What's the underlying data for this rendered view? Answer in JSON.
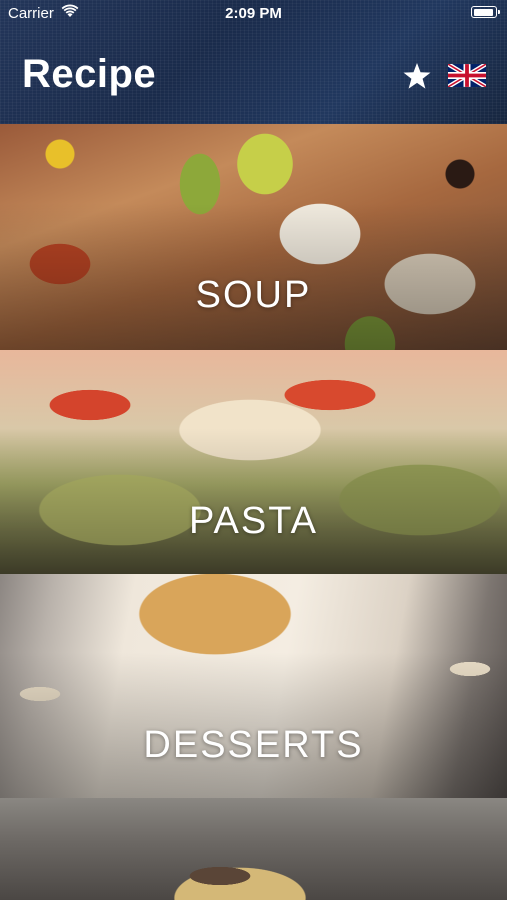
{
  "status_bar": {
    "carrier": "Carrier",
    "time": "2:09 PM"
  },
  "header": {
    "title": "Recipe",
    "favorites_icon": "star-icon",
    "language_icon": "uk-flag-icon"
  },
  "categories": [
    {
      "label": "SOUP"
    },
    {
      "label": "PASTA"
    },
    {
      "label": "DESSERTS"
    },
    {
      "label": ""
    }
  ],
  "colors": {
    "header_bg": "#1f3256",
    "label_text": "#ffffff"
  }
}
